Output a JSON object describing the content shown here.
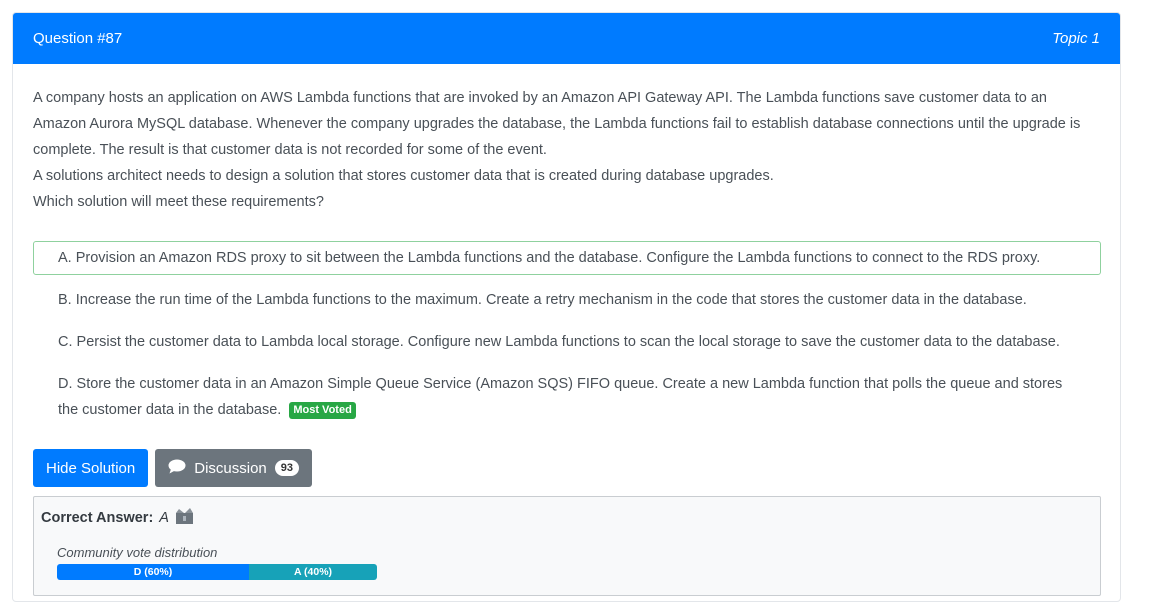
{
  "header": {
    "question_number": "Question #87",
    "topic": "Topic 1",
    "color": "#007bff"
  },
  "question": {
    "lines": [
      "A company hosts an application on AWS Lambda functions that are invoked by an Amazon API Gateway API. The Lambda functions save customer data to an Amazon Aurora MySQL database. Whenever the company upgrades the database, the Lambda functions fail to establish database connections until the upgrade is complete. The result is that customer data is not recorded for some of the event.",
      "A solutions architect needs to design a solution that stores customer data that is created during database upgrades.",
      "Which solution will meet these requirements?"
    ]
  },
  "choices": [
    {
      "text": "A. Provision an Amazon RDS proxy to sit between the Lambda functions and the database. Configure the Lambda functions to connect to the RDS proxy.",
      "correct": true
    },
    {
      "text": "B. Increase the run time of the Lambda functions to the maximum. Create a retry mechanism in the code that stores the customer data in the database."
    },
    {
      "text": "C. Persist the customer data to Lambda local storage. Configure new Lambda functions to scan the local storage to save the customer data to the database."
    },
    {
      "text": "D. Store the customer data in an Amazon Simple Queue Service (Amazon SQS) FIFO queue. Create a new Lambda function that polls the queue and stores the customer data in the database.",
      "badge": "Most Voted"
    }
  ],
  "actions": {
    "hide_solution_label": "Hide Solution",
    "discussion_label": "Discussion",
    "discussion_count": "93",
    "discussion_icon": "speech-bubble-icon"
  },
  "answer": {
    "label": "Correct Answer:",
    "value": "A",
    "icon": "reveal-box-icon"
  },
  "vote": {
    "title": "Community vote distribution",
    "segments": [
      {
        "label": "D (60%)",
        "percent": 60,
        "color": "#007bff"
      },
      {
        "label": "A (40%)",
        "percent": 40,
        "color": "#17a2b8"
      }
    ]
  }
}
